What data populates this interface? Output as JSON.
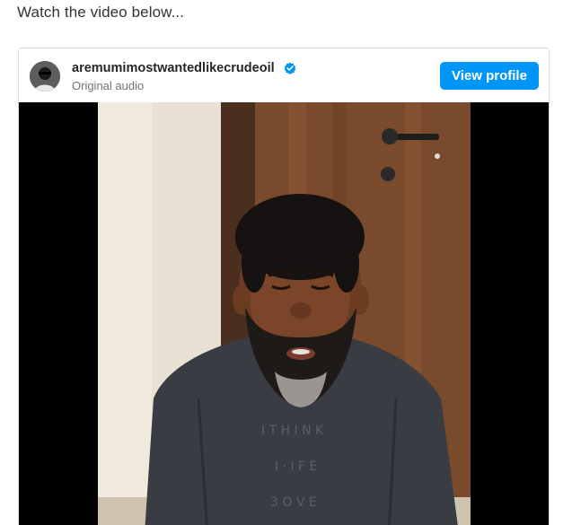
{
  "intro_text": "Watch the video below...",
  "embed": {
    "username": "aremumimostwantedlikecrudeoil",
    "verified_icon": "verified-badge-icon",
    "subtitle": "Original audio",
    "view_profile_label": "View profile",
    "accent_color": "#0095f6"
  },
  "video": {
    "frame_description_icon": "video-frame"
  }
}
